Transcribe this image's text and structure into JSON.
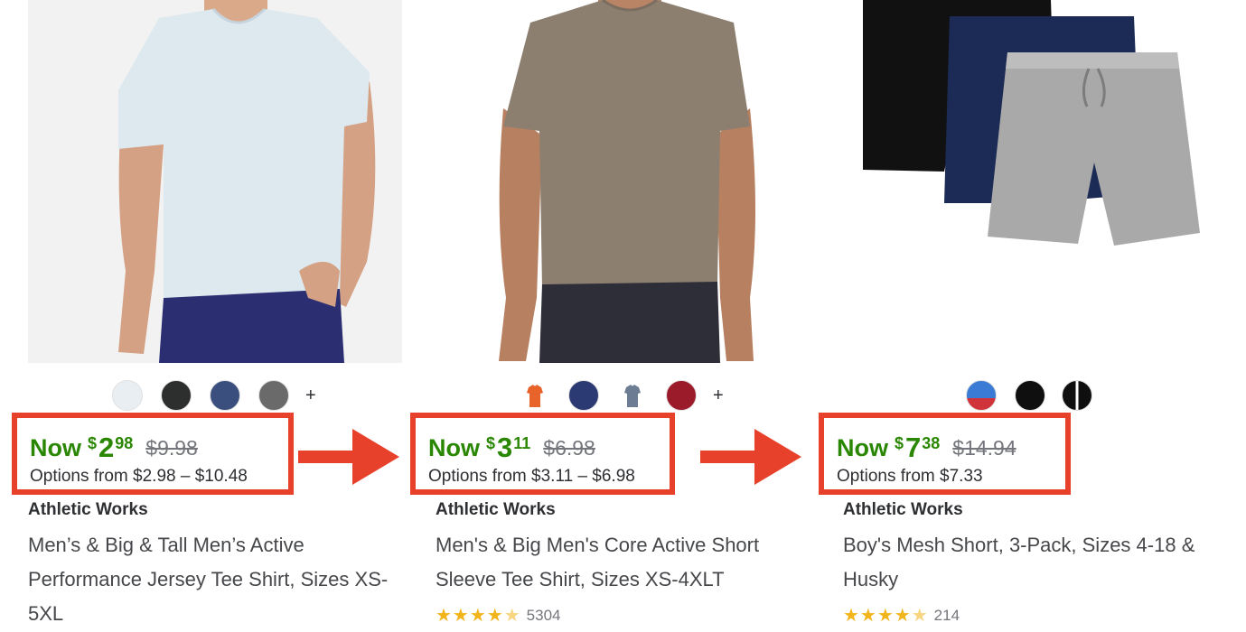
{
  "colors": {
    "sale_green": "#2a8703",
    "highlight_red": "#e8412b",
    "text": "#2e2f32",
    "star_yellow": "#f2b41b"
  },
  "products": [
    {
      "brand": "Athletic Works",
      "title": "Men’s & Big & Tall Men’s Active Performance Jersey Tee Shirt, Sizes XS-5XL",
      "price": {
        "now_label": "Now",
        "currency": "$",
        "whole": "2",
        "cents": "98",
        "was": "$9.98"
      },
      "options": "Options from $2.98 – $10.48",
      "swatches": [
        "light-blue",
        "black-heather",
        "navy-heather",
        "gray-heather"
      ],
      "more_swatches": "+",
      "rating": null,
      "review_count": ""
    },
    {
      "brand": "Athletic Works",
      "title": "Men's & Big Men's Core Active Short Sleeve Tee Shirt, Sizes XS-4XLT",
      "price": {
        "now_label": "Now",
        "currency": "$",
        "whole": "3",
        "cents": "11",
        "was": "$6.98"
      },
      "options": "Options from $3.11 – $6.98",
      "swatches": [
        "orange-shirt",
        "navy",
        "blue-gray-shirt",
        "burgundy"
      ],
      "more_swatches": "+",
      "rating": 4.5,
      "review_count": "5304"
    },
    {
      "brand": "Athletic Works",
      "title": "Boy's Mesh Short, 3-Pack, Sizes 4-18 & Husky",
      "price": {
        "now_label": "Now",
        "currency": "$",
        "whole": "7",
        "cents": "38",
        "was": "$14.94"
      },
      "options": "Options from $7.33",
      "swatches": [
        "blue-red",
        "black",
        "black-white"
      ],
      "more_swatches": "",
      "rating": 4.5,
      "review_count": "214"
    }
  ],
  "annotations": [
    "arrow-right-icon",
    "arrow-right-icon"
  ]
}
